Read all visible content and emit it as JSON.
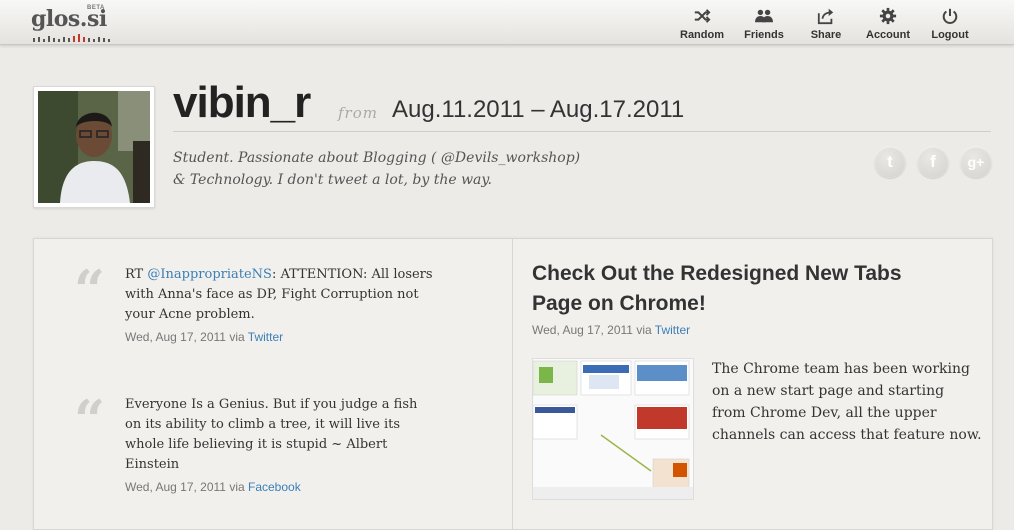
{
  "header": {
    "logo": "glos.si",
    "beta": "BETA",
    "nav": [
      {
        "label": "Random",
        "icon": "shuffle-icon"
      },
      {
        "label": "Friends",
        "icon": "friends-icon"
      },
      {
        "label": "Share",
        "icon": "share-icon"
      },
      {
        "label": "Account",
        "icon": "gear-icon"
      },
      {
        "label": "Logout",
        "icon": "power-icon"
      }
    ]
  },
  "profile": {
    "username": "vibin_r",
    "from_label": "from",
    "date_range": "Aug.11.2011 – Aug.17.2011",
    "bio_line1": "Student. Passionate about Blogging ( @Devils_workshop)",
    "bio_line2": "& Technology. I don't tweet a lot, by the way.",
    "social": [
      {
        "icon": "twitter-icon",
        "glyph": "t"
      },
      {
        "icon": "facebook-icon",
        "glyph": "f"
      },
      {
        "icon": "google-plus-icon",
        "glyph": "g+"
      }
    ]
  },
  "quotes": [
    {
      "prefix": "RT ",
      "mention": "@InappropriateNS",
      "text": ": ATTENTION: All losers with Anna's face as DP, Fight Corruption not your Acne problem.",
      "date": "Wed, Aug 17, 2011",
      "via": "via",
      "source": "Twitter"
    },
    {
      "prefix": "",
      "mention": "",
      "text": "Everyone Is a Genius. But if you judge a fish on its ability to climb a tree, it will live its whole life believing it is stupid ~ Albert Einstein",
      "date": "Wed, Aug 17, 2011",
      "via": "via",
      "source": "Facebook"
    }
  ],
  "post": {
    "title": "Check Out the Redesigned New Tabs Page on Chrome!",
    "date": "Wed, Aug 17, 2011",
    "via": "via",
    "source": "Twitter",
    "body": "The Chrome team has been working on a new start page and starting from Chrome Dev, all the upper channels can access that feature now."
  },
  "colors": {
    "link": "#3b7fb6",
    "background": "#ecebe8"
  }
}
